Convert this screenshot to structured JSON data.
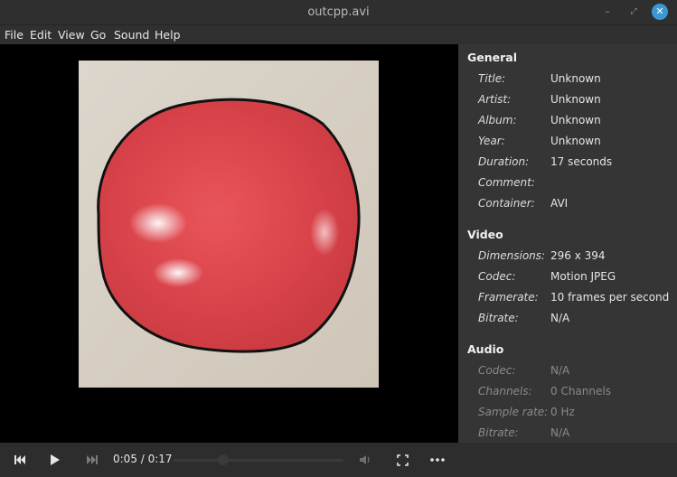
{
  "window": {
    "title": "outcpp.avi"
  },
  "menu": [
    "File",
    "Edit",
    "View",
    "Go",
    "Sound",
    "Help"
  ],
  "properties": {
    "general": {
      "heading": "General",
      "rows": [
        {
          "label": "Title:",
          "value": "Unknown"
        },
        {
          "label": "Artist:",
          "value": "Unknown"
        },
        {
          "label": "Album:",
          "value": "Unknown"
        },
        {
          "label": "Year:",
          "value": "Unknown"
        },
        {
          "label": "Duration:",
          "value": "17 seconds"
        },
        {
          "label": "Comment:",
          "value": ""
        },
        {
          "label": "Container:",
          "value": "AVI"
        }
      ]
    },
    "video": {
      "heading": "Video",
      "rows": [
        {
          "label": "Dimensions:",
          "value": "296 x 394"
        },
        {
          "label": "Codec:",
          "value": "Motion JPEG"
        },
        {
          "label": "Framerate:",
          "value": "10 frames per second"
        },
        {
          "label": "Bitrate:",
          "value": "N/A"
        }
      ]
    },
    "audio": {
      "heading": "Audio",
      "rows": [
        {
          "label": "Codec:",
          "value": "N/A"
        },
        {
          "label": "Channels:",
          "value": "0 Channels"
        },
        {
          "label": "Sample rate:",
          "value": "0 Hz"
        },
        {
          "label": "Bitrate:",
          "value": "N/A"
        }
      ]
    }
  },
  "controls": {
    "time": "0:05 / 0:17",
    "progress_fraction": 0.29
  },
  "colors": {
    "accent": "#3b98d5",
    "video_bg": "#000000",
    "panel_bg": "#353535"
  }
}
